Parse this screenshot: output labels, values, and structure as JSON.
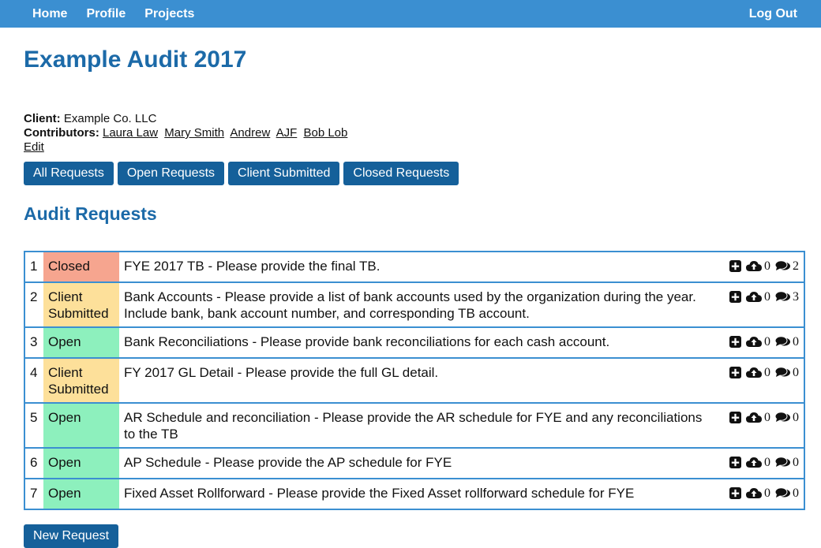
{
  "nav": {
    "links": [
      "Home",
      "Profile",
      "Projects"
    ],
    "logout": "Log Out"
  },
  "page_title": "Example Audit 2017",
  "client": {
    "label": "Client:",
    "value": "Example Co. LLC"
  },
  "contributors": {
    "label": "Contributors:",
    "names": [
      "Laura Law",
      "Mary Smith",
      "Andrew",
      "AJF",
      "Bob Lob"
    ]
  },
  "edit_label": "Edit",
  "filters": [
    "All Requests",
    "Open Requests",
    "Client Submitted",
    "Closed Requests"
  ],
  "section_title": "Audit Requests",
  "requests": [
    {
      "num": "1",
      "status": "Closed",
      "status_kind": "closed",
      "text": "FYE 2017 TB - Please provide the final TB.",
      "uploads": "0",
      "comments": "2"
    },
    {
      "num": "2",
      "status": "Client Submitted",
      "status_kind": "submitted",
      "text": "Bank Accounts - Please provide a list of bank accounts used by the organization during the year. Include bank, bank account number, and corresponding TB account.",
      "uploads": "0",
      "comments": "3"
    },
    {
      "num": "3",
      "status": "Open",
      "status_kind": "open",
      "text": "Bank Reconciliations - Please provide bank reconciliations for each cash account.",
      "uploads": "0",
      "comments": "0"
    },
    {
      "num": "4",
      "status": "Client Submitted",
      "status_kind": "submitted",
      "text": "FY 2017 GL Detail - Please provide the full GL detail.",
      "uploads": "0",
      "comments": "0"
    },
    {
      "num": "5",
      "status": "Open",
      "status_kind": "open",
      "text": "AR Schedule and reconciliation - Please provide the AR schedule for FYE and any reconciliations to the TB",
      "uploads": "0",
      "comments": "0"
    },
    {
      "num": "6",
      "status": "Open",
      "status_kind": "open",
      "text": "AP Schedule - Please provide the AP schedule for FYE",
      "uploads": "0",
      "comments": "0"
    },
    {
      "num": "7",
      "status": "Open",
      "status_kind": "open",
      "text": "Fixed Asset Rollforward - Please provide the Fixed Asset rollforward schedule for FYE",
      "uploads": "0",
      "comments": "0"
    }
  ],
  "new_request_label": "New Request",
  "icons": {
    "add": "plus-square-icon",
    "upload": "cloud-upload-icon",
    "comment": "comments-icon"
  },
  "colors": {
    "nav": "#3b8fd1",
    "title": "#1c6aa8",
    "button": "#15609a",
    "closed": "#f6a58f",
    "submitted": "#fde09a",
    "open": "#8df0bd"
  }
}
